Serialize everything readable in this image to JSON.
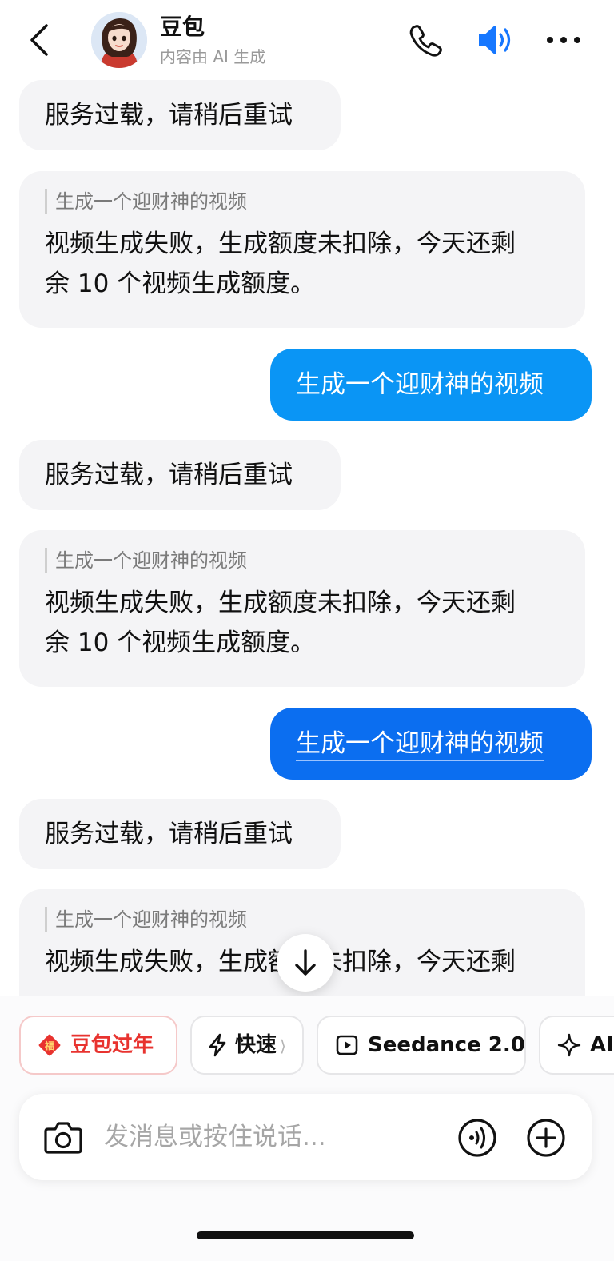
{
  "header": {
    "title": "豆包",
    "subtitle": "内容由 AI 生成"
  },
  "messages": [
    {
      "role": "ai",
      "text": "服务过载，请稍后重试"
    },
    {
      "role": "ai",
      "quote": "生成一个迎财神的视频",
      "text_line1": "视频生成失败，生成额度未扣除，今天还剩",
      "text_line2": "余 10 个视频生成额度。"
    },
    {
      "role": "user",
      "text": "生成一个迎财神的视频"
    },
    {
      "role": "ai",
      "text": "服务过载，请稍后重试"
    },
    {
      "role": "ai",
      "quote": "生成一个迎财神的视频",
      "text_line1": "视频生成失败，生成额度未扣除，今天还剩",
      "text_line2": "余 10 个视频生成额度。"
    },
    {
      "role": "user",
      "text": "生成一个迎财神的视频"
    },
    {
      "role": "ai",
      "text": "服务过载，请稍后重试"
    },
    {
      "role": "ai",
      "quote": "生成一个迎财神的视频",
      "text_line1": "视频生成失败，生成额度未扣除，今天还剩"
    }
  ],
  "quick_actions": [
    {
      "label": "豆包过年",
      "icon": "fortune-icon"
    },
    {
      "label": "快速",
      "icon": "lightning-icon",
      "chevron": "⟩"
    },
    {
      "label": "Seedance 2.0",
      "icon": "play-icon"
    },
    {
      "label": "AI",
      "icon": "sparkle-icon"
    }
  ],
  "input": {
    "placeholder": "发消息或按住说话..."
  },
  "colors": {
    "user_bubble": "#0a95f5",
    "user_bubble_active": "#0b6ef0",
    "ai_bubble": "#f4f4f6",
    "accent": "#1677ff",
    "festival": "#e8332f"
  }
}
